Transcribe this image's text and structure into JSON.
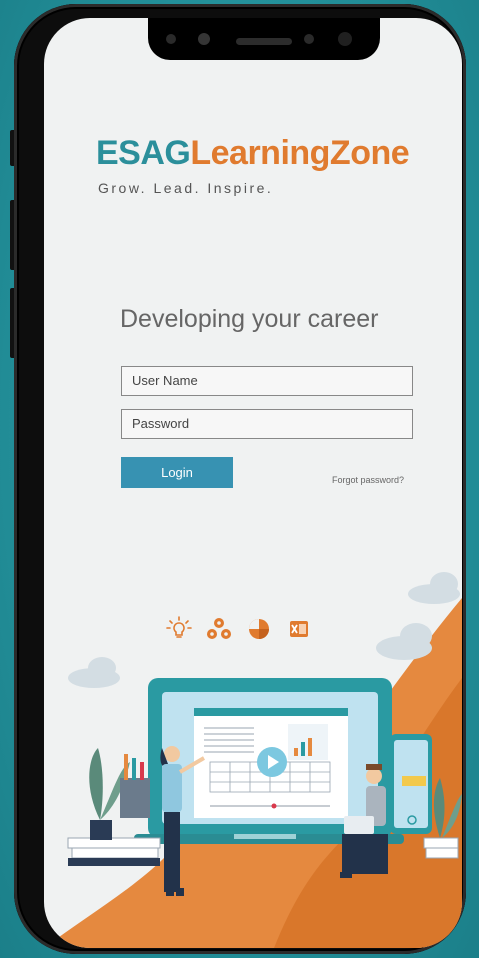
{
  "brand": {
    "logo_part1": "ESAG",
    "logo_part2": "LearningZone",
    "tagline": "Grow. Lead. Inspire."
  },
  "headline": "Developing your career",
  "form": {
    "username_placeholder": "User Name",
    "password_placeholder": "Password",
    "login_label": "Login",
    "forgot_label": "Forgot password?"
  },
  "icons": [
    "lightbulb-icon",
    "gears-icon",
    "pie-chart-icon",
    "excel-icon"
  ],
  "colors": {
    "teal": "#2b8f9b",
    "orange": "#e07b2f",
    "button": "#3792b2",
    "background": "#2a9aa2"
  }
}
